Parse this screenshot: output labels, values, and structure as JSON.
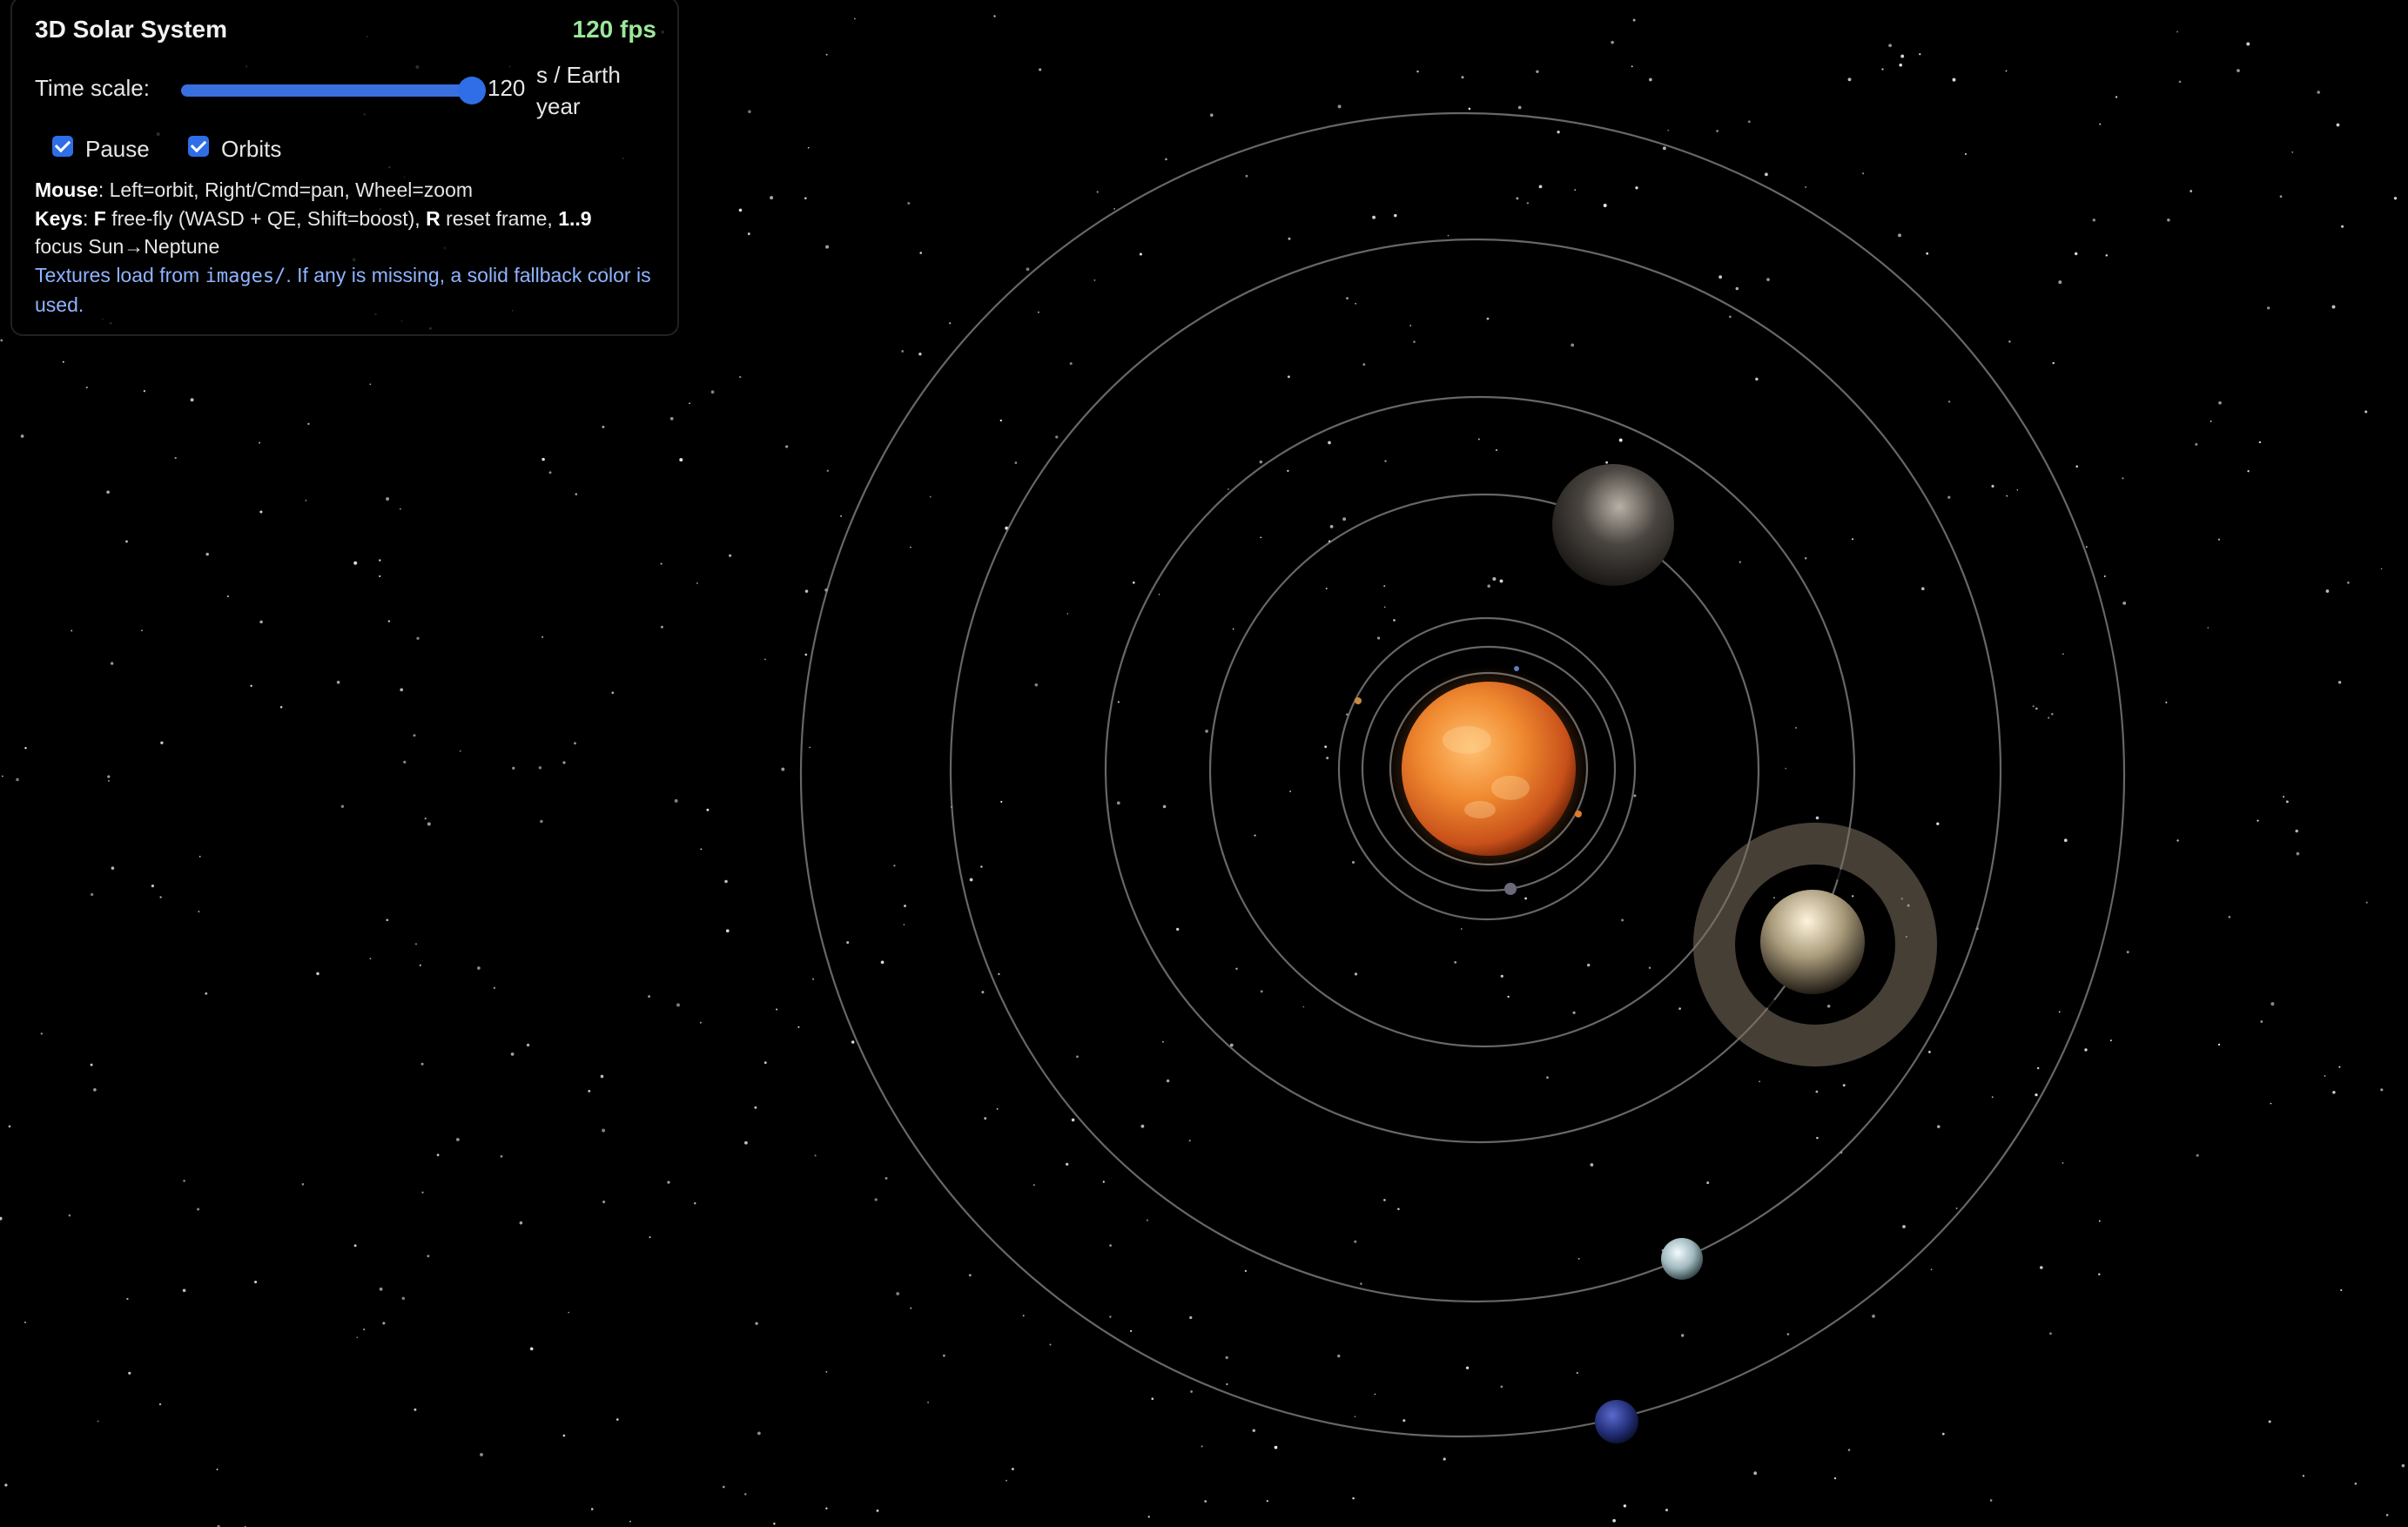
{
  "panel": {
    "title": "3D Solar System",
    "fps": "120 fps",
    "time_scale": {
      "label": "Time scale:",
      "value": "120",
      "unit": "s / Earth year",
      "slider_fraction": 1.0
    },
    "pause": {
      "label": "Pause",
      "checked": true
    },
    "orbits": {
      "label": "Orbits",
      "checked": true
    },
    "help": {
      "mouse_key": "Mouse",
      "mouse_text": ": Left=orbit, Right/Cmd=pan, Wheel=zoom",
      "keys_key": "Keys",
      "keys_sep": ": ",
      "key_f": "F",
      "key_f_text": " free-fly (WASD + QE, Shift=boost), ",
      "key_r": "R",
      "key_r_text": " reset frame, ",
      "key_nums": "1..9",
      "focus_text": "focus Sun→Neptune",
      "tex_prefix": "Textures load from ",
      "tex_path": "images/",
      "tex_suffix": ". If any is missing, a solid fallback color is used."
    }
  },
  "scene": {
    "background": "#000000",
    "orbit_color": "#8a8a8a",
    "bodies": [
      {
        "name": "sun",
        "color": "#e8742a"
      },
      {
        "name": "mercury",
        "color": "#7a6a5a"
      },
      {
        "name": "venus",
        "color": "#c88a3a"
      },
      {
        "name": "earth",
        "color": "#5a7fc0"
      },
      {
        "name": "mars",
        "color": "#b05a2a"
      },
      {
        "name": "jupiter",
        "color": "#5a5550"
      },
      {
        "name": "saturn",
        "color": "#d8c8a8"
      },
      {
        "name": "uranus",
        "color": "#cfe3e8"
      },
      {
        "name": "neptune",
        "color": "#2a3a8a"
      }
    ]
  }
}
